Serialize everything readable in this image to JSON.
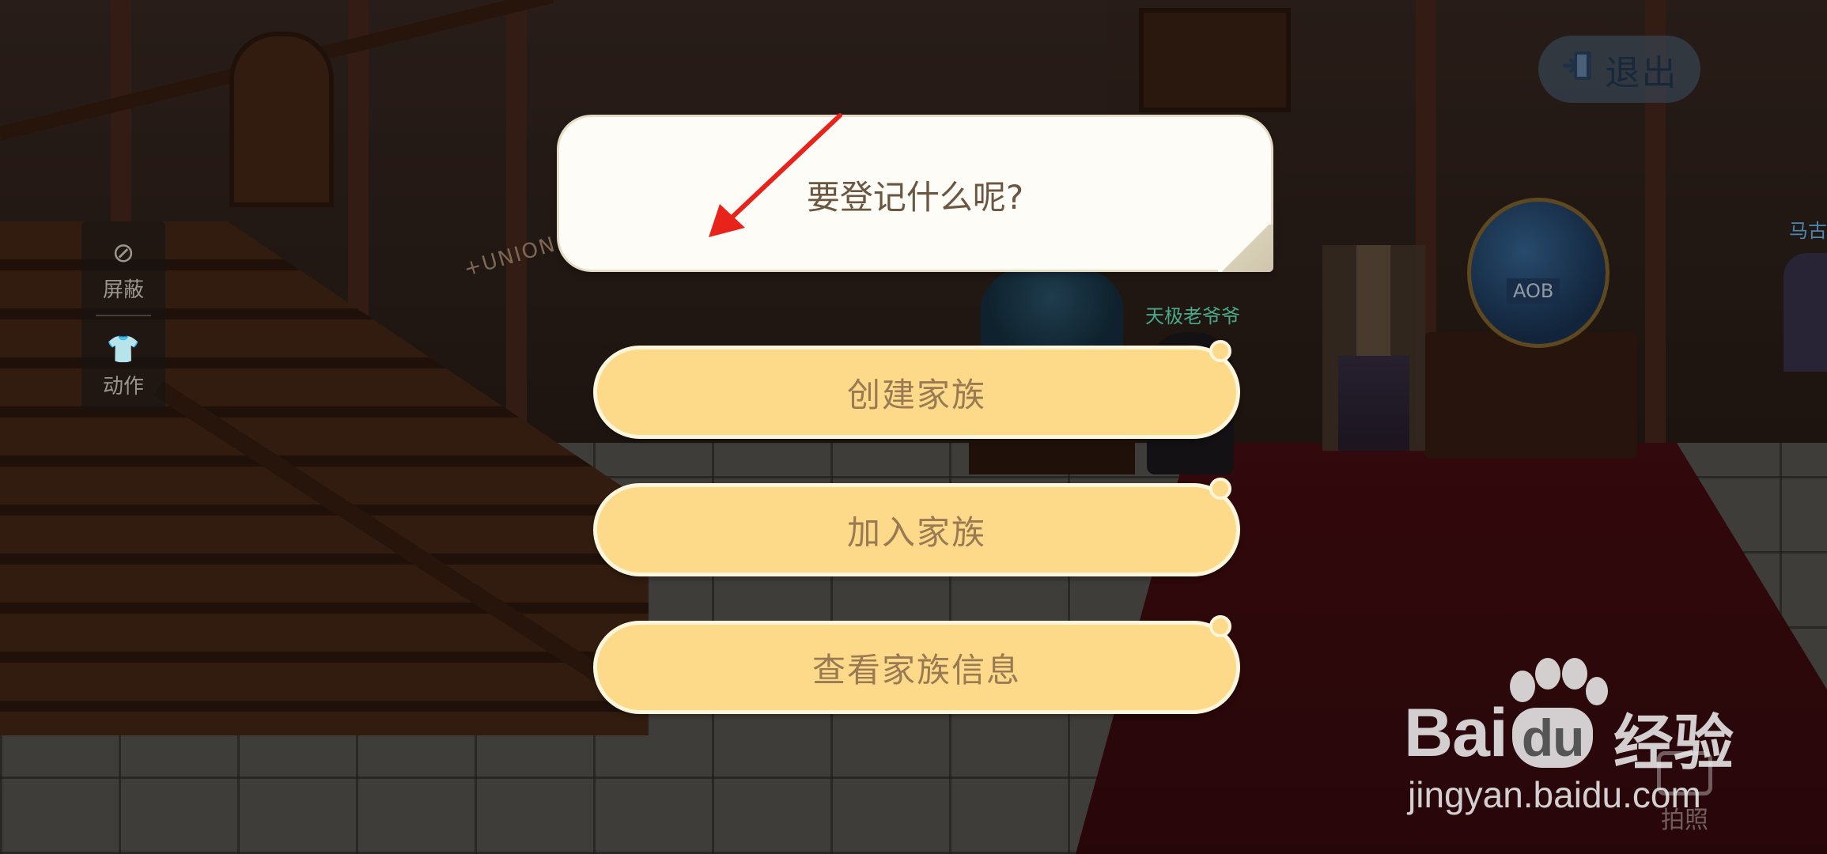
{
  "side_panel": {
    "items": [
      {
        "icon": "block-icon",
        "label": "屏蔽"
      },
      {
        "icon": "shirt-icon",
        "label": "动作"
      }
    ]
  },
  "header": {
    "exit": {
      "icon": "exit-door-icon",
      "label": "退出"
    }
  },
  "scene": {
    "npc_name": "天极老爷爷",
    "npc_name_right": "马古",
    "sign_text": "+UNION",
    "globe_label": "AOB"
  },
  "dialog": {
    "prompt": "要登记什么呢?"
  },
  "options": [
    {
      "label": "创建家族"
    },
    {
      "label": "加入家族"
    },
    {
      "label": "查看家族信息"
    }
  ],
  "camera": {
    "icon": "camera-icon",
    "label": "拍照"
  },
  "watermark": {
    "logo_prefix": "Bai",
    "logo_du": "du",
    "logo_suffix": "经验",
    "url": "jingyan.baidu.com"
  },
  "colors": {
    "option_fill": "#fdd98a",
    "option_border": "#fff6dc",
    "option_text": "#9a7a52",
    "dialog_fill": "#fdfcf6",
    "dialog_text": "#6b5642",
    "arrow": "#e8231c"
  }
}
